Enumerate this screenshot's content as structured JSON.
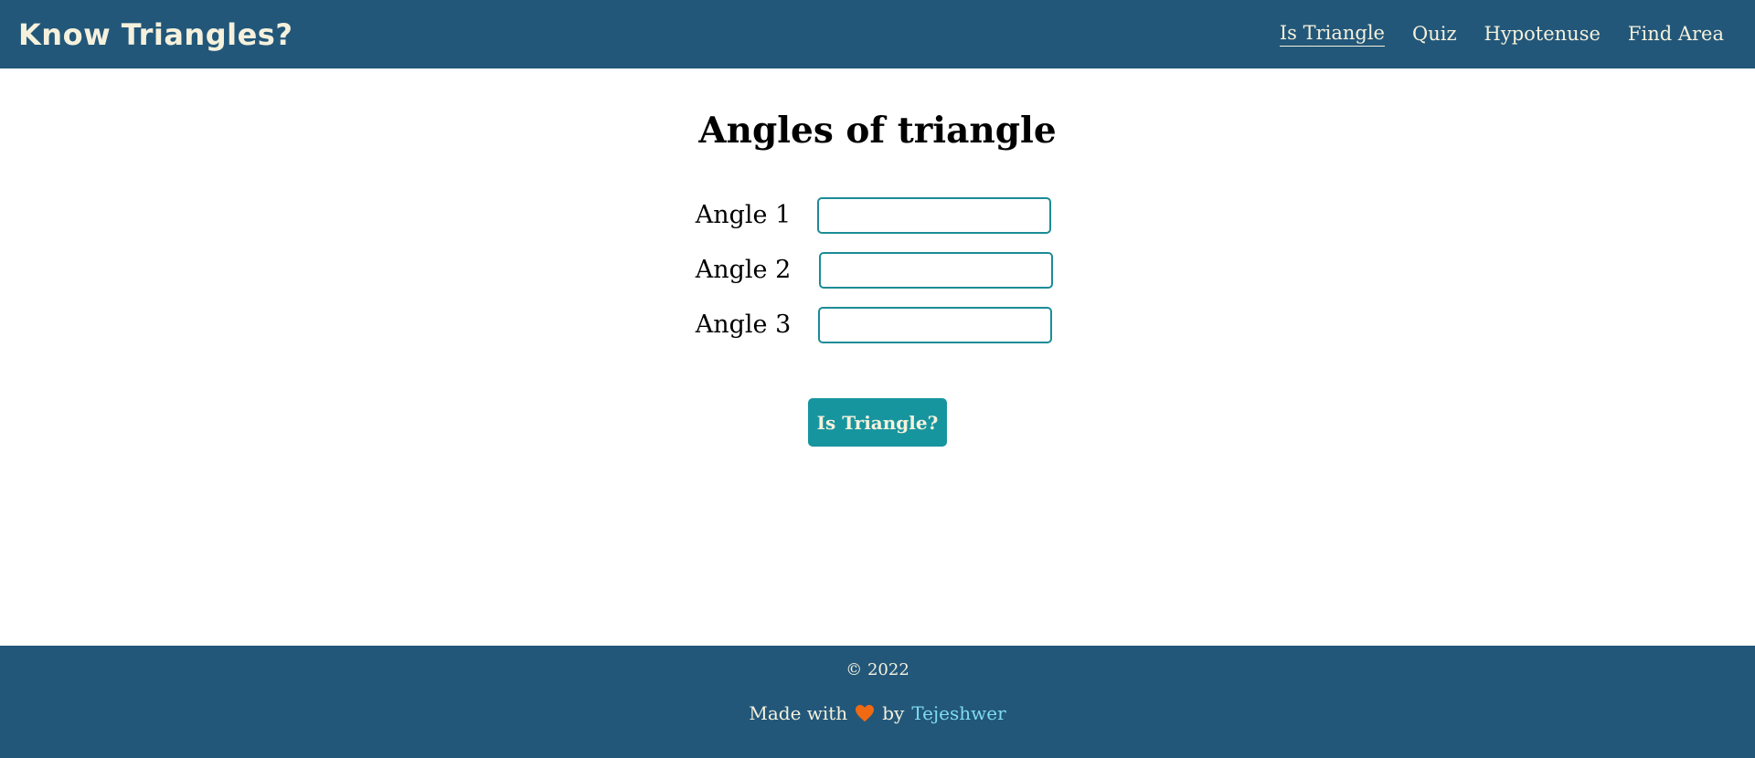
{
  "header": {
    "brand": "Know Triangles?",
    "nav": [
      {
        "label": "Is Triangle",
        "active": true
      },
      {
        "label": "Quiz",
        "active": false
      },
      {
        "label": "Hypotenuse",
        "active": false
      },
      {
        "label": "Find Area",
        "active": false
      }
    ]
  },
  "main": {
    "title": "Angles of triangle",
    "fields": [
      {
        "label": "Angle 1",
        "value": ""
      },
      {
        "label": "Angle 2",
        "value": ""
      },
      {
        "label": "Angle 3",
        "value": ""
      }
    ],
    "submit_label": "Is Triangle?"
  },
  "footer": {
    "copyright": "© 2022",
    "made_with_prefix": "Made with",
    "heart_icon": "heart-icon",
    "heart_color": "#f06a14",
    "by_text": "by",
    "author": "Tejeshwer"
  },
  "colors": {
    "navbar_bg": "#22577a",
    "accent": "#17959f",
    "text_light": "#f5f1dc",
    "link": "#7fdcf0"
  }
}
